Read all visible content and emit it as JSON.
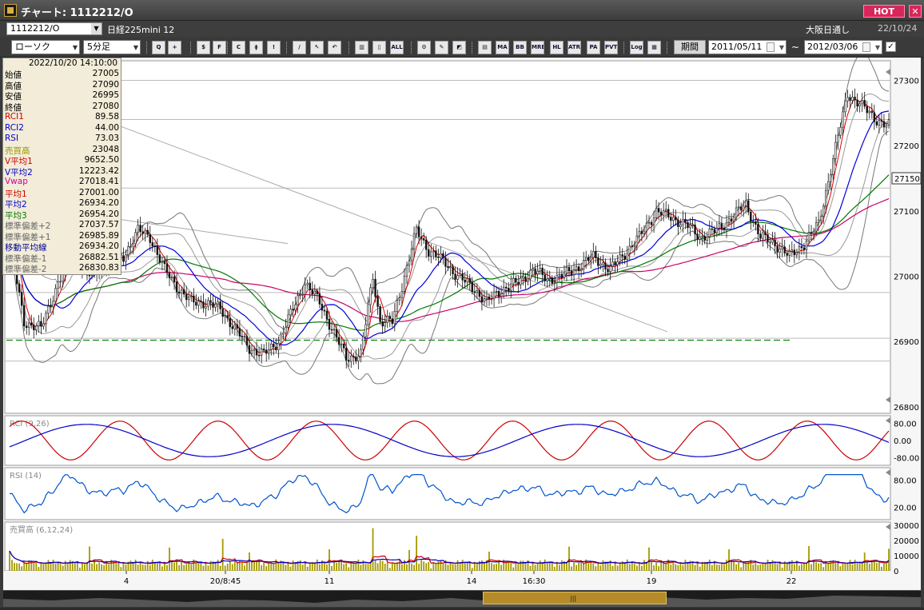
{
  "window": {
    "title": "チャート: 1112212/O",
    "hot_label": "HOT",
    "close_label": "✕"
  },
  "info_bar": {
    "symbol": "1112212/O",
    "instrument": "日経225mini 12",
    "market": "大阪日通し",
    "date": "22/10/24"
  },
  "toolbar": {
    "chart_type": "ローソク",
    "interval": "5分足",
    "period_button": "期間",
    "date_from": "2011/05/11",
    "date_to": "2012/03/06",
    "range_separator": "~",
    "icons": [
      {
        "name": "zoom-icon",
        "label": "Q"
      },
      {
        "name": "crosshair-icon",
        "label": "+"
      },
      {
        "name": "trade-icon",
        "label": "$"
      },
      {
        "name": "find-icon",
        "label": "F"
      },
      {
        "name": "chart-icon",
        "label": "C"
      },
      {
        "name": "ohlc-icon",
        "label": "ǂ"
      },
      {
        "name": "alert-icon",
        "label": "!"
      },
      {
        "name": "pen-icon",
        "label": "/"
      },
      {
        "name": "cursor-icon",
        "label": "↖"
      },
      {
        "name": "undo-icon",
        "label": "↶"
      },
      {
        "name": "bar-icon",
        "label": "▥"
      },
      {
        "name": "candle-icon",
        "label": "▯"
      },
      {
        "name": "all-icon",
        "label": "ALL"
      },
      {
        "name": "settings-icon",
        "label": "⚙"
      },
      {
        "name": "tools-icon",
        "label": "✎"
      },
      {
        "name": "color-icon",
        "label": "◩"
      },
      {
        "name": "indicator-icon",
        "label": "▤"
      },
      {
        "name": "ma-icon",
        "label": "MA"
      },
      {
        "name": "bb-icon",
        "label": "BB"
      },
      {
        "name": "mre-icon",
        "label": "MRE"
      },
      {
        "name": "hl-icon",
        "label": "HL"
      },
      {
        "name": "atr-icon",
        "label": "ATR"
      },
      {
        "name": "pa-icon",
        "label": "PA"
      },
      {
        "name": "pvt-icon",
        "label": "PVT"
      },
      {
        "name": "log-icon",
        "label": "Log"
      },
      {
        "name": "layout-icon",
        "label": "▦"
      }
    ],
    "check_mark": "✓"
  },
  "data_panel": {
    "datetime": "2022/10/20 14:10:00",
    "rows": [
      {
        "label": "始値",
        "value": "27005",
        "color": "#000000"
      },
      {
        "label": "高値",
        "value": "27090",
        "color": "#000000"
      },
      {
        "label": "安値",
        "value": "26995",
        "color": "#000000"
      },
      {
        "label": "終値",
        "value": "27080",
        "color": "#000000"
      },
      {
        "label": "RCI1",
        "value": "89.58",
        "color": "#cc0000"
      },
      {
        "label": "RCI2",
        "value": "44.00",
        "color": "#0000cc"
      },
      {
        "label": "RSI",
        "value": "73.03",
        "color": "#0000cc"
      },
      {
        "label": "売買高",
        "value": "23048",
        "color": "#999900"
      },
      {
        "label": "V平均1",
        "value": "9652.50",
        "color": "#cc0000"
      },
      {
        "label": "V平均2",
        "value": "12223.42",
        "color": "#0000cc"
      },
      {
        "label": "Vwap",
        "value": "27018.41",
        "color": "#cc0099"
      },
      {
        "label": "平均1",
        "value": "27001.00",
        "color": "#cc0000"
      },
      {
        "label": "平均2",
        "value": "26934.20",
        "color": "#0000cc"
      },
      {
        "label": "平均3",
        "value": "26954.20",
        "color": "#007700"
      },
      {
        "label": "標準偏差+2",
        "value": "27037.57",
        "color": "#666666"
      },
      {
        "label": "標準偏差+1",
        "value": "26985.89",
        "color": "#666666"
      },
      {
        "label": "移動平均線",
        "value": "26934.20",
        "color": "#000099"
      },
      {
        "label": "標準偏差-1",
        "value": "26882.51",
        "color": "#666666"
      },
      {
        "label": "標準偏差-2",
        "value": "26830.83",
        "color": "#666666"
      }
    ]
  },
  "chart_data": [
    {
      "type": "candlestick",
      "title": "",
      "ylim": [
        26790,
        27330
      ],
      "y_ticks": [
        "27300",
        "27200",
        "27100",
        "27000",
        "26900",
        "26800"
      ],
      "x_tick_labels": [
        "4",
        "20/8:45",
        "11",
        "14",
        "16:30",
        "19",
        "22"
      ],
      "current_price": "27150",
      "reference_lines": [
        27300,
        27240,
        27135,
        27030,
        26975,
        26905,
        26870
      ],
      "support_line": 26902,
      "close_anchors": [
        [
          0,
          27050
        ],
        [
          6,
          26930
        ],
        [
          13,
          26920
        ],
        [
          20,
          26990
        ],
        [
          26,
          27030
        ],
        [
          33,
          27000
        ],
        [
          40,
          27020
        ],
        [
          47,
          27030
        ],
        [
          53,
          27070
        ],
        [
          58,
          27060
        ],
        [
          64,
          27010
        ],
        [
          70,
          26980
        ],
        [
          75,
          26960
        ],
        [
          81,
          26960
        ],
        [
          87,
          26950
        ],
        [
          93,
          26920
        ],
        [
          99,
          26890
        ],
        [
          105,
          26880
        ],
        [
          111,
          26900
        ],
        [
          117,
          26950
        ],
        [
          122,
          26990
        ],
        [
          128,
          26960
        ],
        [
          133,
          26920
        ],
        [
          139,
          26875
        ],
        [
          145,
          26880
        ],
        [
          150,
          27000
        ],
        [
          153,
          26930
        ],
        [
          158,
          26930
        ],
        [
          163,
          27000
        ],
        [
          168,
          27070
        ],
        [
          173,
          27040
        ],
        [
          180,
          27020
        ],
        [
          185,
          27000
        ],
        [
          192,
          26980
        ],
        [
          197,
          26960
        ],
        [
          203,
          26980
        ],
        [
          210,
          26990
        ],
        [
          216,
          27010
        ],
        [
          222,
          26995
        ],
        [
          228,
          27000
        ],
        [
          235,
          27015
        ],
        [
          241,
          27030
        ],
        [
          248,
          27010
        ],
        [
          254,
          27035
        ],
        [
          260,
          27060
        ],
        [
          267,
          27100
        ],
        [
          273,
          27090
        ],
        [
          279,
          27080
        ],
        [
          285,
          27060
        ],
        [
          292,
          27070
        ],
        [
          298,
          27090
        ],
        [
          304,
          27110
        ],
        [
          310,
          27060
        ],
        [
          316,
          27050
        ],
        [
          322,
          27030
        ],
        [
          328,
          27050
        ],
        [
          334,
          27080
        ],
        [
          340,
          27180
        ],
        [
          346,
          27280
        ],
        [
          352,
          27260
        ],
        [
          358,
          27240
        ],
        [
          362,
          27230
        ]
      ]
    },
    {
      "type": "line",
      "title": "RCI (9,26)",
      "ylim": [
        -100,
        100
      ],
      "y_ticks": [
        "80.00",
        "0.00",
        "-80.00"
      ],
      "series": [
        {
          "name": "RCI1",
          "color": "#cc0000"
        },
        {
          "name": "RCI2",
          "color": "#0000cc"
        }
      ]
    },
    {
      "type": "line",
      "title": "RSI (14)",
      "ylim": [
        0,
        100
      ],
      "y_ticks": [
        "80.00",
        "20.00"
      ],
      "series": [
        {
          "name": "RSI",
          "color": "#0055cc"
        }
      ]
    },
    {
      "type": "bar",
      "title": "売買高 (6,12,24)",
      "ylim": [
        0,
        32000
      ],
      "y_ticks": [
        "30000",
        "20000",
        "10000",
        "0"
      ],
      "series": [
        {
          "name": "売買高",
          "color": "#a59a00"
        },
        {
          "name": "V平均1",
          "color": "#cc0000"
        },
        {
          "name": "V平均2",
          "color": "#0000cc"
        }
      ]
    }
  ],
  "colors": {
    "candle_up": "#ffffff",
    "candle_down": "#111111",
    "ma1": "#e00000",
    "ma2": "#0000dd",
    "ma3": "#007700",
    "vwap": "#cc0066",
    "band": "#666666",
    "support": "#118811"
  }
}
